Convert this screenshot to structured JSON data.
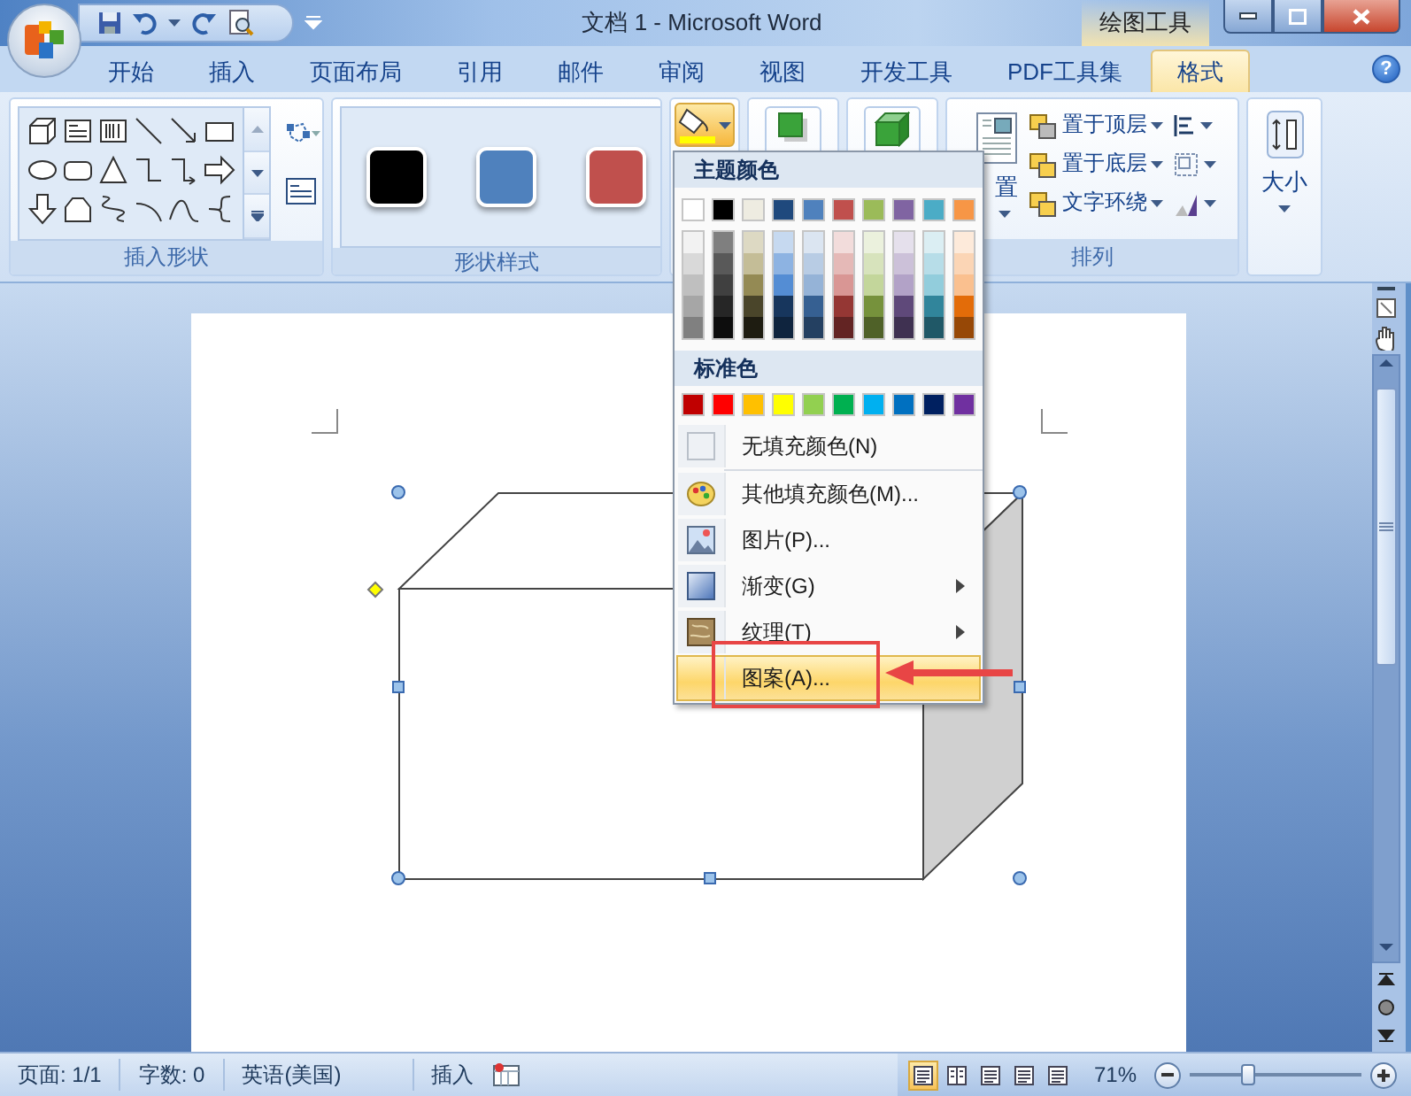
{
  "window": {
    "title": "文档 1 - Microsoft Word",
    "context_label": "绘图工具"
  },
  "tabs": [
    {
      "label": "开始",
      "selected": false
    },
    {
      "label": "插入",
      "selected": false
    },
    {
      "label": "页面布局",
      "selected": false
    },
    {
      "label": "引用",
      "selected": false
    },
    {
      "label": "邮件",
      "selected": false
    },
    {
      "label": "审阅",
      "selected": false
    },
    {
      "label": "视图",
      "selected": false
    },
    {
      "label": "开发工具",
      "selected": false
    },
    {
      "label": "PDF工具集",
      "selected": false
    },
    {
      "label": "格式",
      "selected": true
    }
  ],
  "help": "?",
  "ribbon": {
    "groups": [
      {
        "kind": "shapes",
        "label": "插入形状"
      },
      {
        "kind": "styles",
        "label": "形状样式",
        "swatches": [
          {
            "color": "#000000"
          },
          {
            "color": "#4f81bd"
          },
          {
            "color": "#c0504d"
          }
        ]
      },
      {
        "kind": "fill",
        "open": true
      },
      {
        "kind": "shadow"
      },
      {
        "kind": "threed"
      },
      {
        "kind": "arrange",
        "label": "排列",
        "button_label": "置",
        "commands": [
          {
            "label": "置于顶层"
          },
          {
            "label": "置于底层"
          },
          {
            "label": "文字环绕"
          }
        ]
      },
      {
        "kind": "size",
        "button_label": "大小"
      }
    ]
  },
  "fill_menu": {
    "theme_heading": "主题颜色",
    "theme_colors": [
      {
        "color": "#ffffff",
        "shades": [
          {
            "color": "#f2f2f2"
          },
          {
            "color": "#d9d9d9"
          },
          {
            "color": "#bfbfbf"
          },
          {
            "color": "#a6a6a6"
          },
          {
            "color": "#808080"
          }
        ]
      },
      {
        "color": "#000000",
        "shades": [
          {
            "color": "#7f7f7f"
          },
          {
            "color": "#595959"
          },
          {
            "color": "#404040"
          },
          {
            "color": "#262626"
          },
          {
            "color": "#0d0d0d"
          }
        ]
      },
      {
        "color": "#eeece1",
        "shades": [
          {
            "color": "#ddd9c3"
          },
          {
            "color": "#c4bd97"
          },
          {
            "color": "#948a54"
          },
          {
            "color": "#4a452a"
          },
          {
            "color": "#1e1c11"
          }
        ]
      },
      {
        "color": "#1f497d",
        "shades": [
          {
            "color": "#c6d9f0"
          },
          {
            "color": "#8db3e2"
          },
          {
            "color": "#548dd4"
          },
          {
            "color": "#17365d"
          },
          {
            "color": "#0f243e"
          }
        ]
      },
      {
        "color": "#4f81bd",
        "shades": [
          {
            "color": "#dbe5f1"
          },
          {
            "color": "#b8cce4"
          },
          {
            "color": "#95b3d7"
          },
          {
            "color": "#366092"
          },
          {
            "color": "#244061"
          }
        ]
      },
      {
        "color": "#c0504d",
        "shades": [
          {
            "color": "#f2dcdb"
          },
          {
            "color": "#e5b9b7"
          },
          {
            "color": "#d99694"
          },
          {
            "color": "#953734"
          },
          {
            "color": "#632423"
          }
        ]
      },
      {
        "color": "#9bbb59",
        "shades": [
          {
            "color": "#ebf1dd"
          },
          {
            "color": "#d7e3bc"
          },
          {
            "color": "#c3d69b"
          },
          {
            "color": "#76923c"
          },
          {
            "color": "#4f6128"
          }
        ]
      },
      {
        "color": "#8064a2",
        "shades": [
          {
            "color": "#e5e0ec"
          },
          {
            "color": "#ccc1d9"
          },
          {
            "color": "#b2a2c7"
          },
          {
            "color": "#5f497a"
          },
          {
            "color": "#3f3151"
          }
        ]
      },
      {
        "color": "#4bacc6",
        "shades": [
          {
            "color": "#dbeef3"
          },
          {
            "color": "#b7dde8"
          },
          {
            "color": "#92cddc"
          },
          {
            "color": "#31859b"
          },
          {
            "color": "#205867"
          }
        ]
      },
      {
        "color": "#f79646",
        "shades": [
          {
            "color": "#fdeada"
          },
          {
            "color": "#fbd5b5"
          },
          {
            "color": "#fac08f"
          },
          {
            "color": "#e36c09"
          },
          {
            "color": "#974806"
          }
        ]
      }
    ],
    "standard_heading": "标准色",
    "standard_colors": [
      {
        "color": "#c00000"
      },
      {
        "color": "#ff0000"
      },
      {
        "color": "#ffc000"
      },
      {
        "color": "#ffff00"
      },
      {
        "color": "#92d050"
      },
      {
        "color": "#00b050"
      },
      {
        "color": "#00b0f0"
      },
      {
        "color": "#0070c0"
      },
      {
        "color": "#002060"
      },
      {
        "color": "#7030a0"
      }
    ],
    "items": [
      {
        "kind": "none",
        "label": "无填充颜色(N)",
        "submenu": false,
        "highlighted": false
      },
      {
        "kind": "palette",
        "label": "其他填充颜色(M)...",
        "submenu": false,
        "highlighted": false
      },
      {
        "kind": "picture",
        "label": "图片(P)...",
        "submenu": false,
        "highlighted": false
      },
      {
        "kind": "gradient",
        "label": "渐变(G)",
        "submenu": true,
        "highlighted": false
      },
      {
        "kind": "texture",
        "label": "纹理(T)",
        "submenu": true,
        "highlighted": false
      },
      {
        "kind": "pattern",
        "label": "图案(A)...",
        "submenu": false,
        "highlighted": true
      }
    ]
  },
  "status_bar": {
    "page": "页面: 1/1",
    "words": "字数: 0",
    "language": "英语(美国)",
    "mode": "插入",
    "views": [
      {
        "selected": true
      },
      {
        "selected": false
      },
      {
        "selected": false
      },
      {
        "selected": false
      },
      {
        "selected": false
      }
    ],
    "zoom": "71%",
    "zoom_slider": {
      "level": 0.34
    }
  }
}
